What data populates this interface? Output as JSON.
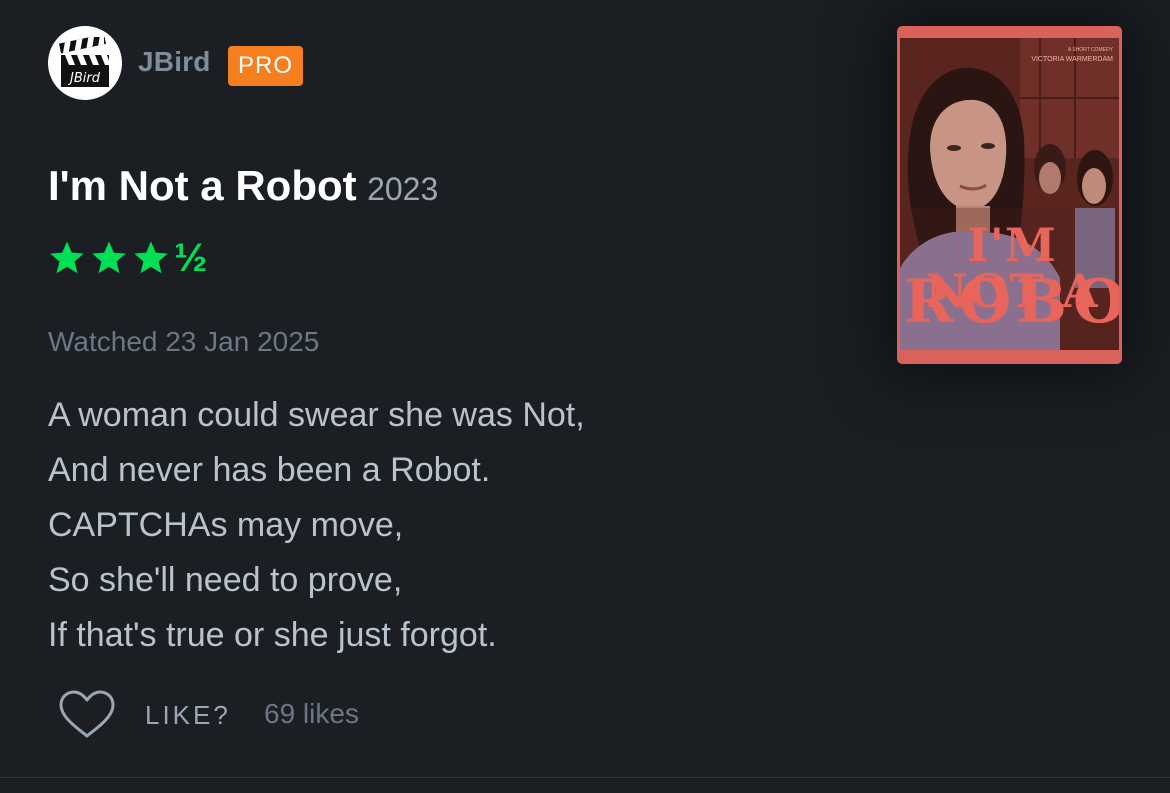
{
  "user": {
    "name": "JBird",
    "badge": "PRO",
    "avatar_text": "JBird"
  },
  "film": {
    "title": "I'm Not a Robot",
    "year": "2023",
    "rating_stars": 3.5,
    "rating_half_glyph": "½"
  },
  "review": {
    "watched": "Watched 23 Jan 2025",
    "lines": [
      "A woman could swear she was Not,",
      "And never has been a Robot.",
      "CAPTCHAs may move,",
      "So she'll need to prove,",
      "If that's true or she just forgot."
    ]
  },
  "actions": {
    "like_label": "LIKE?",
    "likes_count": "69 likes"
  },
  "poster": {
    "credit_top": "A SHORT COMEDY",
    "credit_name": "VICTORIA WARMERDAM",
    "title_line1": "I'M NOT A",
    "title_line2": "ROBOT"
  },
  "colors": {
    "background": "#1b1f24",
    "star_green": "#00e054",
    "pro_orange": "#f57e1f",
    "poster_red": "#d9625a"
  },
  "icons": {
    "avatar": "clapperboard-icon",
    "star": "star-icon",
    "like": "heart-outline-icon"
  }
}
